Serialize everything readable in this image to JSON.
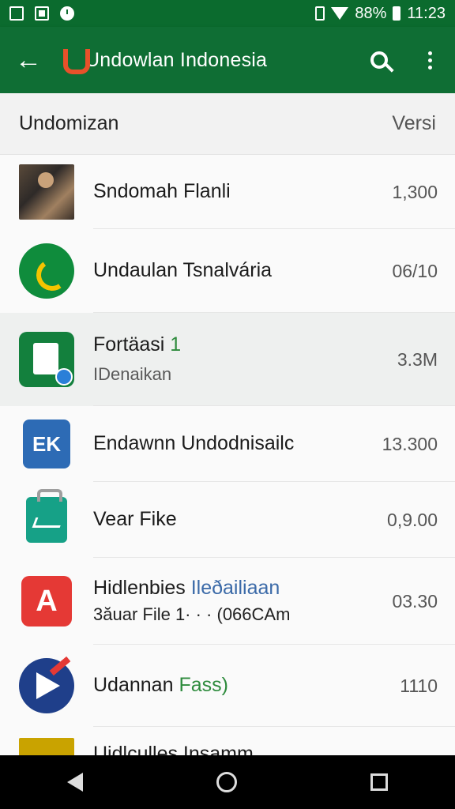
{
  "status_bar": {
    "battery_text": "88%",
    "time": "11:23"
  },
  "app_bar": {
    "title": "Undowlan Indonesia",
    "back_icon": "back-arrow-icon",
    "search_icon": "search-icon",
    "more_icon": "more-vert-icon"
  },
  "list_header": {
    "left": "Undomizan",
    "right": "Versi"
  },
  "items": [
    {
      "title": "Sndomah Flanli",
      "value": "1,300",
      "icon": "photo-thumbnail-icon"
    },
    {
      "title": "Undaulan Tsnalvária",
      "value": "06/10",
      "icon": "phone-icon"
    },
    {
      "title": "Fortäasi",
      "title_accent": "1",
      "subtitle": "IDenaikan",
      "value": "3.3M",
      "icon": "document-icon"
    },
    {
      "title": "Endawnn Undodnisailc",
      "value": "13.300",
      "icon": "ek-app-icon"
    },
    {
      "title": "Vear Fike",
      "value": "0,9.00",
      "icon": "shopping-bag-icon"
    },
    {
      "title": "Hidlenbies",
      "title_accent": "Ileðailiaan",
      "subtitle": "3ăuar File  1·    ·  ·  (066CAm",
      "value": "03.30",
      "icon": "a-app-icon"
    },
    {
      "title": "Udannan",
      "title_accent": "Fass)",
      "value": "1110",
      "icon": "play-app-icon"
    },
    {
      "title": "Uidlculles Insamm",
      "value": "",
      "icon": "yellow-app-icon"
    }
  ],
  "colors": {
    "app_bar": "#0f6e34",
    "status_bar": "#0b6b2e",
    "accent_green": "#2e8b3d"
  }
}
